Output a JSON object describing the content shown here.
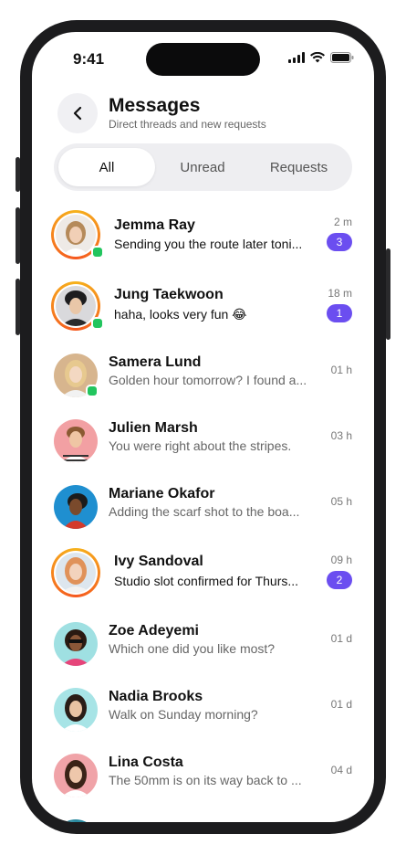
{
  "status": {
    "time": "9:41"
  },
  "header": {
    "title": "Messages",
    "subtitle": "Direct threads and new requests"
  },
  "tabs": [
    {
      "label": "All",
      "active": true
    },
    {
      "label": "Unread",
      "active": false
    },
    {
      "label": "Requests",
      "active": false
    }
  ],
  "threads": [
    {
      "name": "Jemma Ray",
      "preview": "Sending you the route later toni...",
      "time": "2 m",
      "badge": "3"
    },
    {
      "name": "Jung Taekwoon",
      "preview": "haha, looks very fun 😂",
      "time": "18 m",
      "badge": "1"
    },
    {
      "name": "Samera Lund",
      "preview": "Golden hour tomorrow? I found a...",
      "time": "01 h"
    },
    {
      "name": "Julien Marsh",
      "preview": "You were right about the stripes.",
      "time": "03 h"
    },
    {
      "name": "Mariane Okafor",
      "preview": "Adding the scarf shot to the boa...",
      "time": "05 h"
    },
    {
      "name": "Ivy Sandoval",
      "preview": "Studio slot confirmed for Thurs...",
      "time": "09 h",
      "badge": "2"
    },
    {
      "name": "Zoe Adeyemi",
      "preview": "Which one did you like most?",
      "time": "01 d"
    },
    {
      "name": "Nadia Brooks",
      "preview": "Walk on Sunday morning?",
      "time": "01 d"
    },
    {
      "name": "Lina Costa",
      "preview": "The 50mm is on its way back to ...",
      "time": "04 d"
    }
  ],
  "icons": {
    "back": "chevron-left-icon",
    "signal": "cellular-signal-icon",
    "wifi": "wifi-icon",
    "battery": "battery-icon"
  },
  "colors": {
    "accent": "#6b4ef0",
    "online": "#22c55e",
    "story_ring_start": "#f6b21c",
    "story_ring_end": "#f5581f"
  }
}
